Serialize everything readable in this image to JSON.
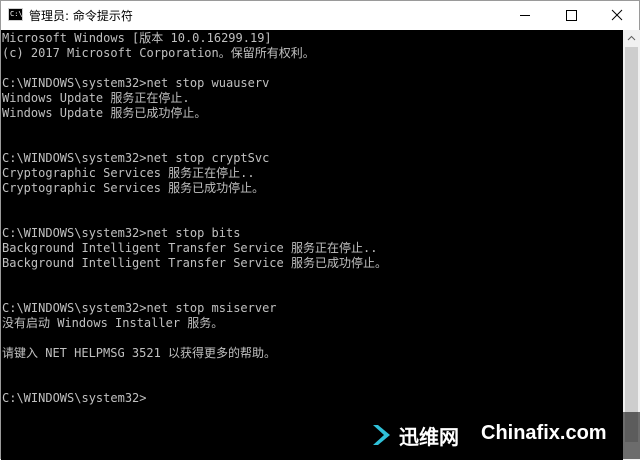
{
  "window": {
    "title": "管理员: 命令提示符",
    "icon": "cmd-icon",
    "icon_text": "C:\\."
  },
  "console": {
    "lines": [
      "Microsoft Windows [版本 10.0.16299.19]",
      "(c) 2017 Microsoft Corporation。保留所有权利。",
      "",
      "C:\\WINDOWS\\system32>net stop wuauserv",
      "Windows Update 服务正在停止.",
      "Windows Update 服务已成功停止。",
      "",
      "",
      "C:\\WINDOWS\\system32>net stop cryptSvc",
      "Cryptographic Services 服务正在停止..",
      "Cryptographic Services 服务已成功停止。",
      "",
      "",
      "C:\\WINDOWS\\system32>net stop bits",
      "Background Intelligent Transfer Service 服务正在停止..",
      "Background Intelligent Transfer Service 服务已成功停止。",
      "",
      "",
      "C:\\WINDOWS\\system32>net stop msiserver",
      "没有启动 Windows Installer 服务。",
      "",
      "请键入 NET HELPMSG 3521 以获得更多的帮助。",
      "",
      "",
      "C:\\WINDOWS\\system32>"
    ]
  },
  "watermark": {
    "brand_cn": "迅维网",
    "brand_en": "Chinafix.com"
  },
  "colors": {
    "console_bg": "#000000",
    "console_text": "#c0c0c0",
    "titlebar_bg": "#ffffff"
  }
}
